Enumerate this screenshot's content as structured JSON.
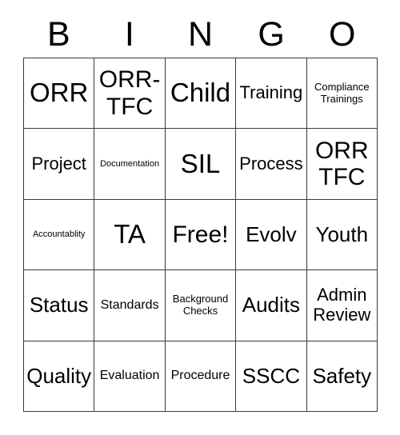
{
  "card": {
    "title": "BINGO",
    "header_letters": [
      "B",
      "I",
      "N",
      "G",
      "O"
    ],
    "colors": {
      "background": "#ffffff",
      "text": "#000000",
      "grid_line": "#3a3a3a"
    },
    "grid": {
      "columns": 5,
      "rows": 5,
      "free_space_label": "Free!",
      "free_space_position": "center"
    },
    "cells": [
      {
        "label": "ORR",
        "size": "xxl"
      },
      {
        "label": "ORR-TFC",
        "size": "xl"
      },
      {
        "label": "Child",
        "size": "xxl"
      },
      {
        "label": "Training",
        "size": "md"
      },
      {
        "label": "Compliance Trainings",
        "size": "xs"
      },
      {
        "label": "Project",
        "size": "md"
      },
      {
        "label": "Documentation",
        "size": "xxs"
      },
      {
        "label": "SIL",
        "size": "xxl"
      },
      {
        "label": "Process",
        "size": "md"
      },
      {
        "label": "ORR TFC",
        "size": "xl"
      },
      {
        "label": "Accountablity",
        "size": "xxs"
      },
      {
        "label": "TA",
        "size": "xxl"
      },
      {
        "label": "Free!",
        "size": "xl"
      },
      {
        "label": "Evolv",
        "size": "lg"
      },
      {
        "label": "Youth",
        "size": "lg"
      },
      {
        "label": "Status",
        "size": "lg"
      },
      {
        "label": "Standards",
        "size": "sm"
      },
      {
        "label": "Background Checks",
        "size": "xs"
      },
      {
        "label": "Audits",
        "size": "lg"
      },
      {
        "label": "Admin Review",
        "size": "md"
      },
      {
        "label": "Quality",
        "size": "lg"
      },
      {
        "label": "Evaluation",
        "size": "sm"
      },
      {
        "label": "Procedure",
        "size": "sm"
      },
      {
        "label": "SSCC",
        "size": "lg"
      },
      {
        "label": "Safety",
        "size": "lg"
      }
    ]
  }
}
